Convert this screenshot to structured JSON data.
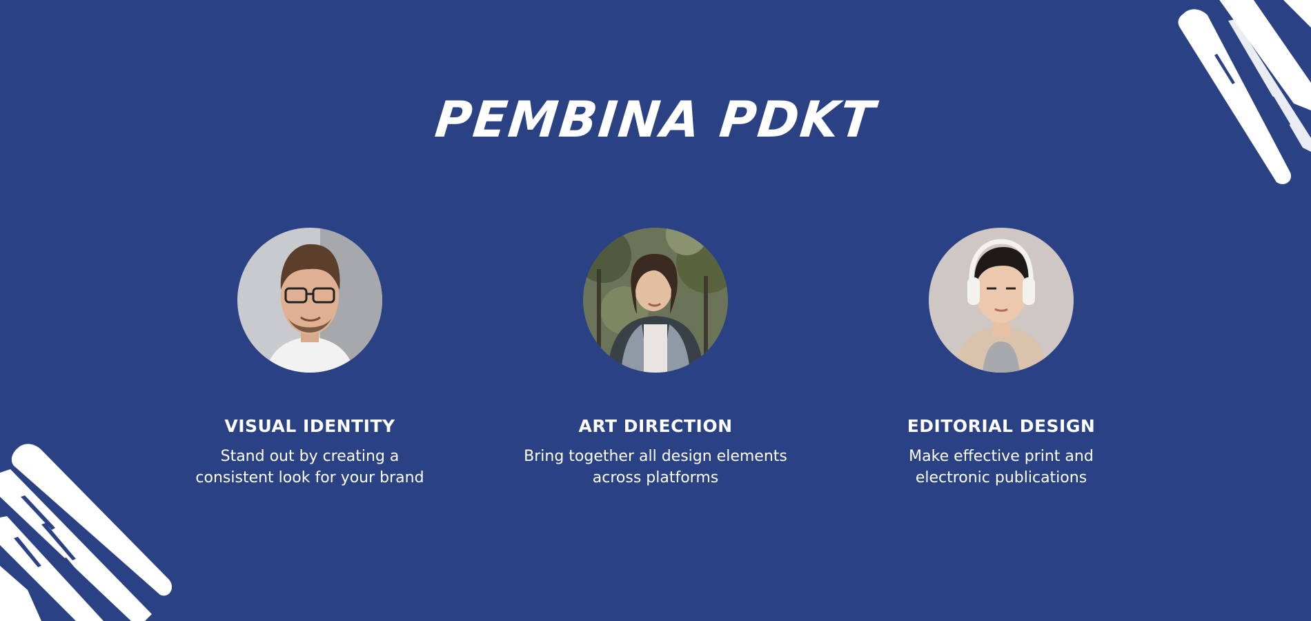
{
  "page": {
    "title": "PEMBINA PDKT",
    "background": "#2a4183",
    "accent": "#ffffff"
  },
  "cards": [
    {
      "avatar_icon": "man-with-glasses-portrait",
      "title": "VISUAL IDENTITY",
      "desc_lines": [
        "Stand out by creating a",
        "consistent look for your brand"
      ]
    },
    {
      "avatar_icon": "woman-in-jacket-portrait",
      "title": "ART DIRECTION",
      "desc_lines": [
        "Bring together all design elements",
        "across platforms"
      ]
    },
    {
      "avatar_icon": "man-with-headphones-portrait",
      "title": "EDITORIAL DESIGN",
      "desc_lines": [
        "Make effective print and",
        "electronic publications"
      ]
    }
  ]
}
